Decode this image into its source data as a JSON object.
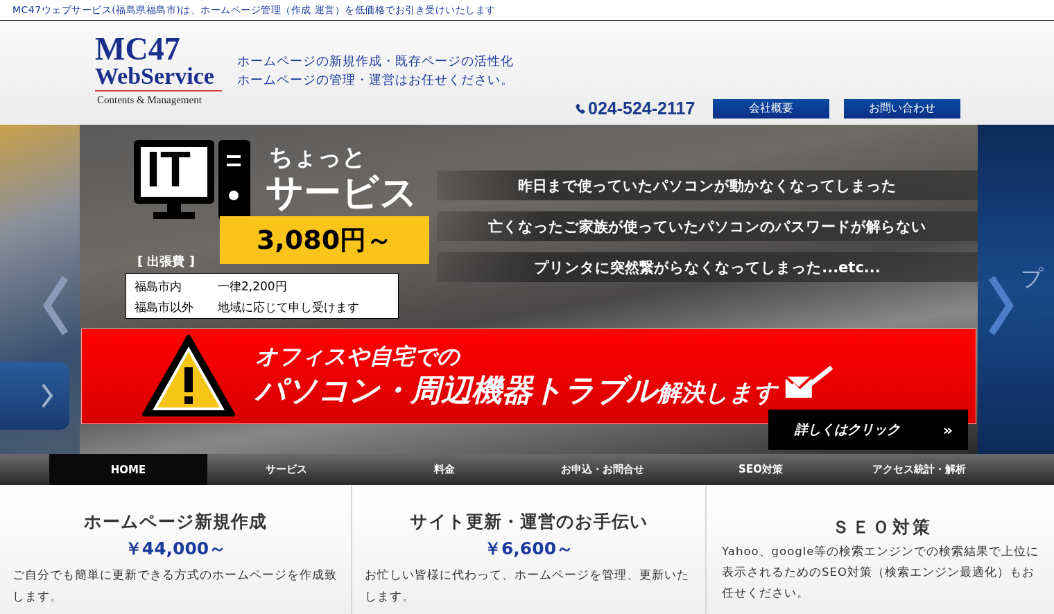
{
  "top_bar": {
    "text": "MC47ウェブサービス(福島県福島市)は、ホームページ管理（作成 運営）を低価格でお引き受けいたします"
  },
  "header": {
    "logo": {
      "line1": "MC47",
      "line2": "WebService",
      "line3": "Contents & Management"
    },
    "tagline": [
      "ホームページの新規作成・既存ページの活性化",
      "ホームページの管理・運営はお任せください。"
    ],
    "phone": "024-524-2117",
    "buttons": [
      "会社概要",
      "お問い合わせ"
    ]
  },
  "slider": {
    "icon_text": "IT",
    "small_title": "ちょっと",
    "title": "サービス",
    "price": "3,080円～",
    "fee_label": "[ 出張費 ]",
    "fee_rows": [
      {
        "area": "福島市内",
        "price": "一律2,200円"
      },
      {
        "area": "福島市以外",
        "price": "地域に応じて申し受けます"
      }
    ],
    "problems": [
      "昨日まで使っていたパソコンが動かなくなってしまった",
      "亡くなったご家族が使っていたパソコンのパスワードが解らない",
      "プリンタに突然繋がらなくなってしまった...etc..."
    ],
    "red_banner": {
      "line1": "オフィスや自宅での",
      "line2_main": "パソコン・周辺機器トラブル",
      "line2_rest": "解決します"
    },
    "cta": {
      "label": "詳しくはクリック",
      "arrow": "»"
    },
    "next_slide_text": "プ"
  },
  "nav": [
    {
      "label": "HOME",
      "selected": true
    },
    {
      "label": "サービス",
      "selected": false
    },
    {
      "label": "料金",
      "selected": false
    },
    {
      "label": "お申込・お問合せ",
      "selected": false
    },
    {
      "label": "SEO対策",
      "selected": false
    },
    {
      "label": "アクセス統計・解析",
      "selected": false
    }
  ],
  "cards": [
    {
      "title": "ホームページ新規作成",
      "price": "￥44,000～",
      "text": "ご自分でも簡単に更新できる方式のホームページを作成致します。"
    },
    {
      "title": "サイト更新・運営のお手伝い",
      "price": "￥6,600～",
      "text": "お忙しい皆様に代わって、ホームページを管理、更新いたします。"
    },
    {
      "title": "ＳＥＯ対策",
      "text": "Yahoo、google等の検索エンジンでの検索結果で上位に表示されるためのSEO対策（検索エンジン最適化）もお任せください。"
    }
  ]
}
